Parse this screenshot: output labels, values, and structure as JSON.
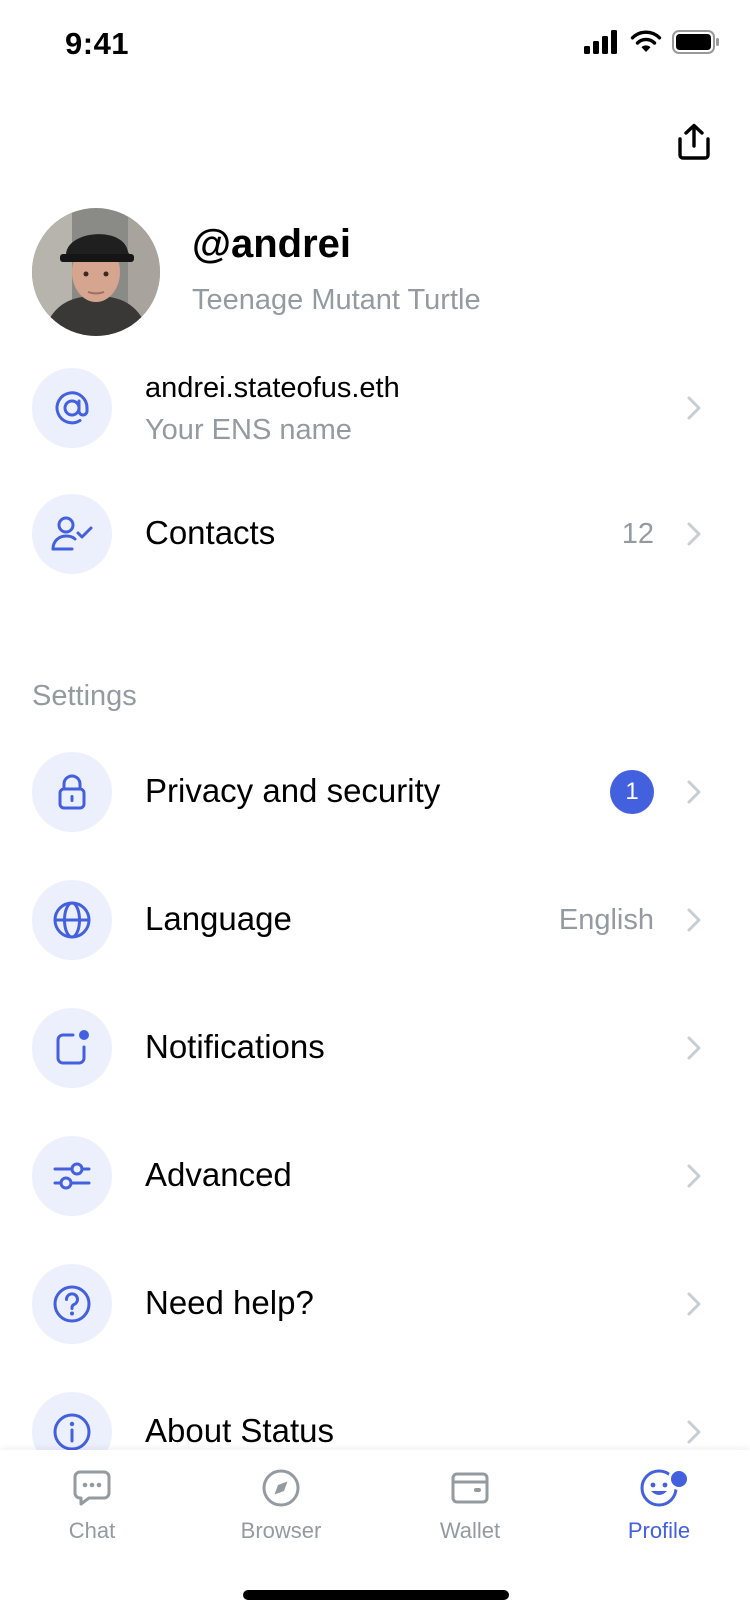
{
  "status_bar": {
    "time": "9:41"
  },
  "profile": {
    "username": "@andrei",
    "bio": "Teenage Mutant Turtle"
  },
  "ens": {
    "title": "andrei.stateofus.eth",
    "subtitle": "Your ENS name",
    "icon": "at-icon"
  },
  "contacts": {
    "title": "Contacts",
    "count": "12",
    "icon": "user-check-icon"
  },
  "settings": {
    "label": "Settings",
    "items": [
      {
        "title": "Privacy and security",
        "badge": "1",
        "icon": "lock-icon"
      },
      {
        "title": "Language",
        "value": "English",
        "icon": "globe-icon"
      },
      {
        "title": "Notifications",
        "icon": "notification-icon"
      },
      {
        "title": "Advanced",
        "icon": "sliders-icon"
      },
      {
        "title": "Need help?",
        "icon": "help-icon"
      },
      {
        "title": "About Status",
        "icon": "info-icon"
      }
    ]
  },
  "tabs": [
    {
      "label": "Chat",
      "icon": "chat-icon",
      "active": false
    },
    {
      "label": "Browser",
      "icon": "compass-icon",
      "active": false
    },
    {
      "label": "Wallet",
      "icon": "wallet-icon",
      "active": false
    },
    {
      "label": "Profile",
      "icon": "profile-icon",
      "active": true
    }
  ],
  "colors": {
    "accent": "#4360DF",
    "icon_bg": "#ECEFFC",
    "muted_text": "#939BA1"
  }
}
